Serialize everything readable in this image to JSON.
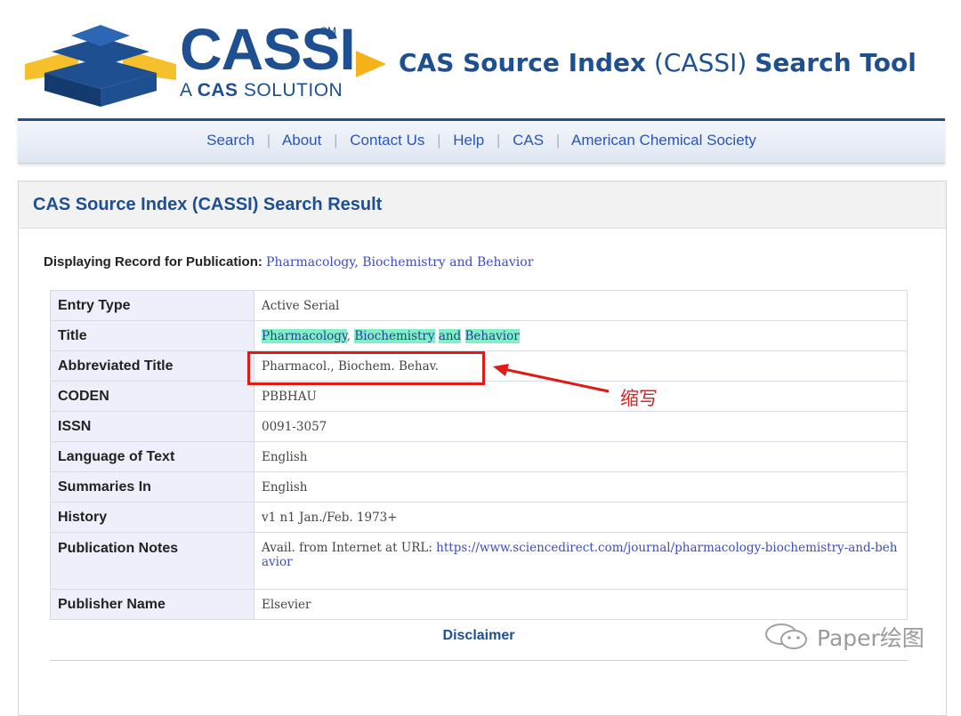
{
  "logo": {
    "brand": "CASSI",
    "sm": "SM",
    "tagline_prefix": "A ",
    "tagline_bold": "CAS",
    "tagline_suffix": " SOLUTION"
  },
  "tool_title": {
    "part1": "CAS Source Index",
    "part2": " (CASSI) ",
    "part3": "Search Tool"
  },
  "nav": {
    "items": [
      "Search",
      "About",
      "Contact Us",
      "Help",
      "CAS",
      "American Chemical Society"
    ],
    "separator": "|"
  },
  "panel": {
    "heading": "CAS Source Index (CASSI) Search Result",
    "display_label": "Displaying Record for Publication:",
    "display_value": "Pharmacology, Biochemistry and Behavior"
  },
  "record": {
    "entry_type": {
      "label": "Entry Type",
      "value": "Active Serial"
    },
    "title": {
      "label": "Title",
      "w1": "Pharmacology",
      "comma": ", ",
      "w2": "Biochemistry",
      "w3": "and",
      "w4": "Behavior"
    },
    "abbrev": {
      "label": "Abbreviated Title",
      "value": "Pharmacol., Biochem. Behav."
    },
    "coden": {
      "label": "CODEN",
      "value": "PBBHAU"
    },
    "issn": {
      "label": "ISSN",
      "value": "0091-3057"
    },
    "language": {
      "label": "Language of Text",
      "value": "English"
    },
    "summaries": {
      "label": "Summaries In",
      "value": "English"
    },
    "history": {
      "label": "History",
      "value": "v1 n1 Jan./Feb. 1973+"
    },
    "notes": {
      "label": "Publication Notes",
      "prefix": "Avail. from Internet at URL: ",
      "url": "https://www.sciencedirect.com/journal/pharmacology-biochemistry-and-behavior"
    },
    "publisher": {
      "label": "Publisher Name",
      "value": "Elsevier"
    }
  },
  "disclaimer": "Disclaimer",
  "annotation": {
    "label": "缩写",
    "color": "#e01919"
  },
  "watermark": "Paper绘图",
  "colors": {
    "brand_blue": "#1d4f91",
    "link_blue": "#2a55b7",
    "highlight": "#7ff0c6",
    "logo_yellow": "#f6c02c"
  }
}
